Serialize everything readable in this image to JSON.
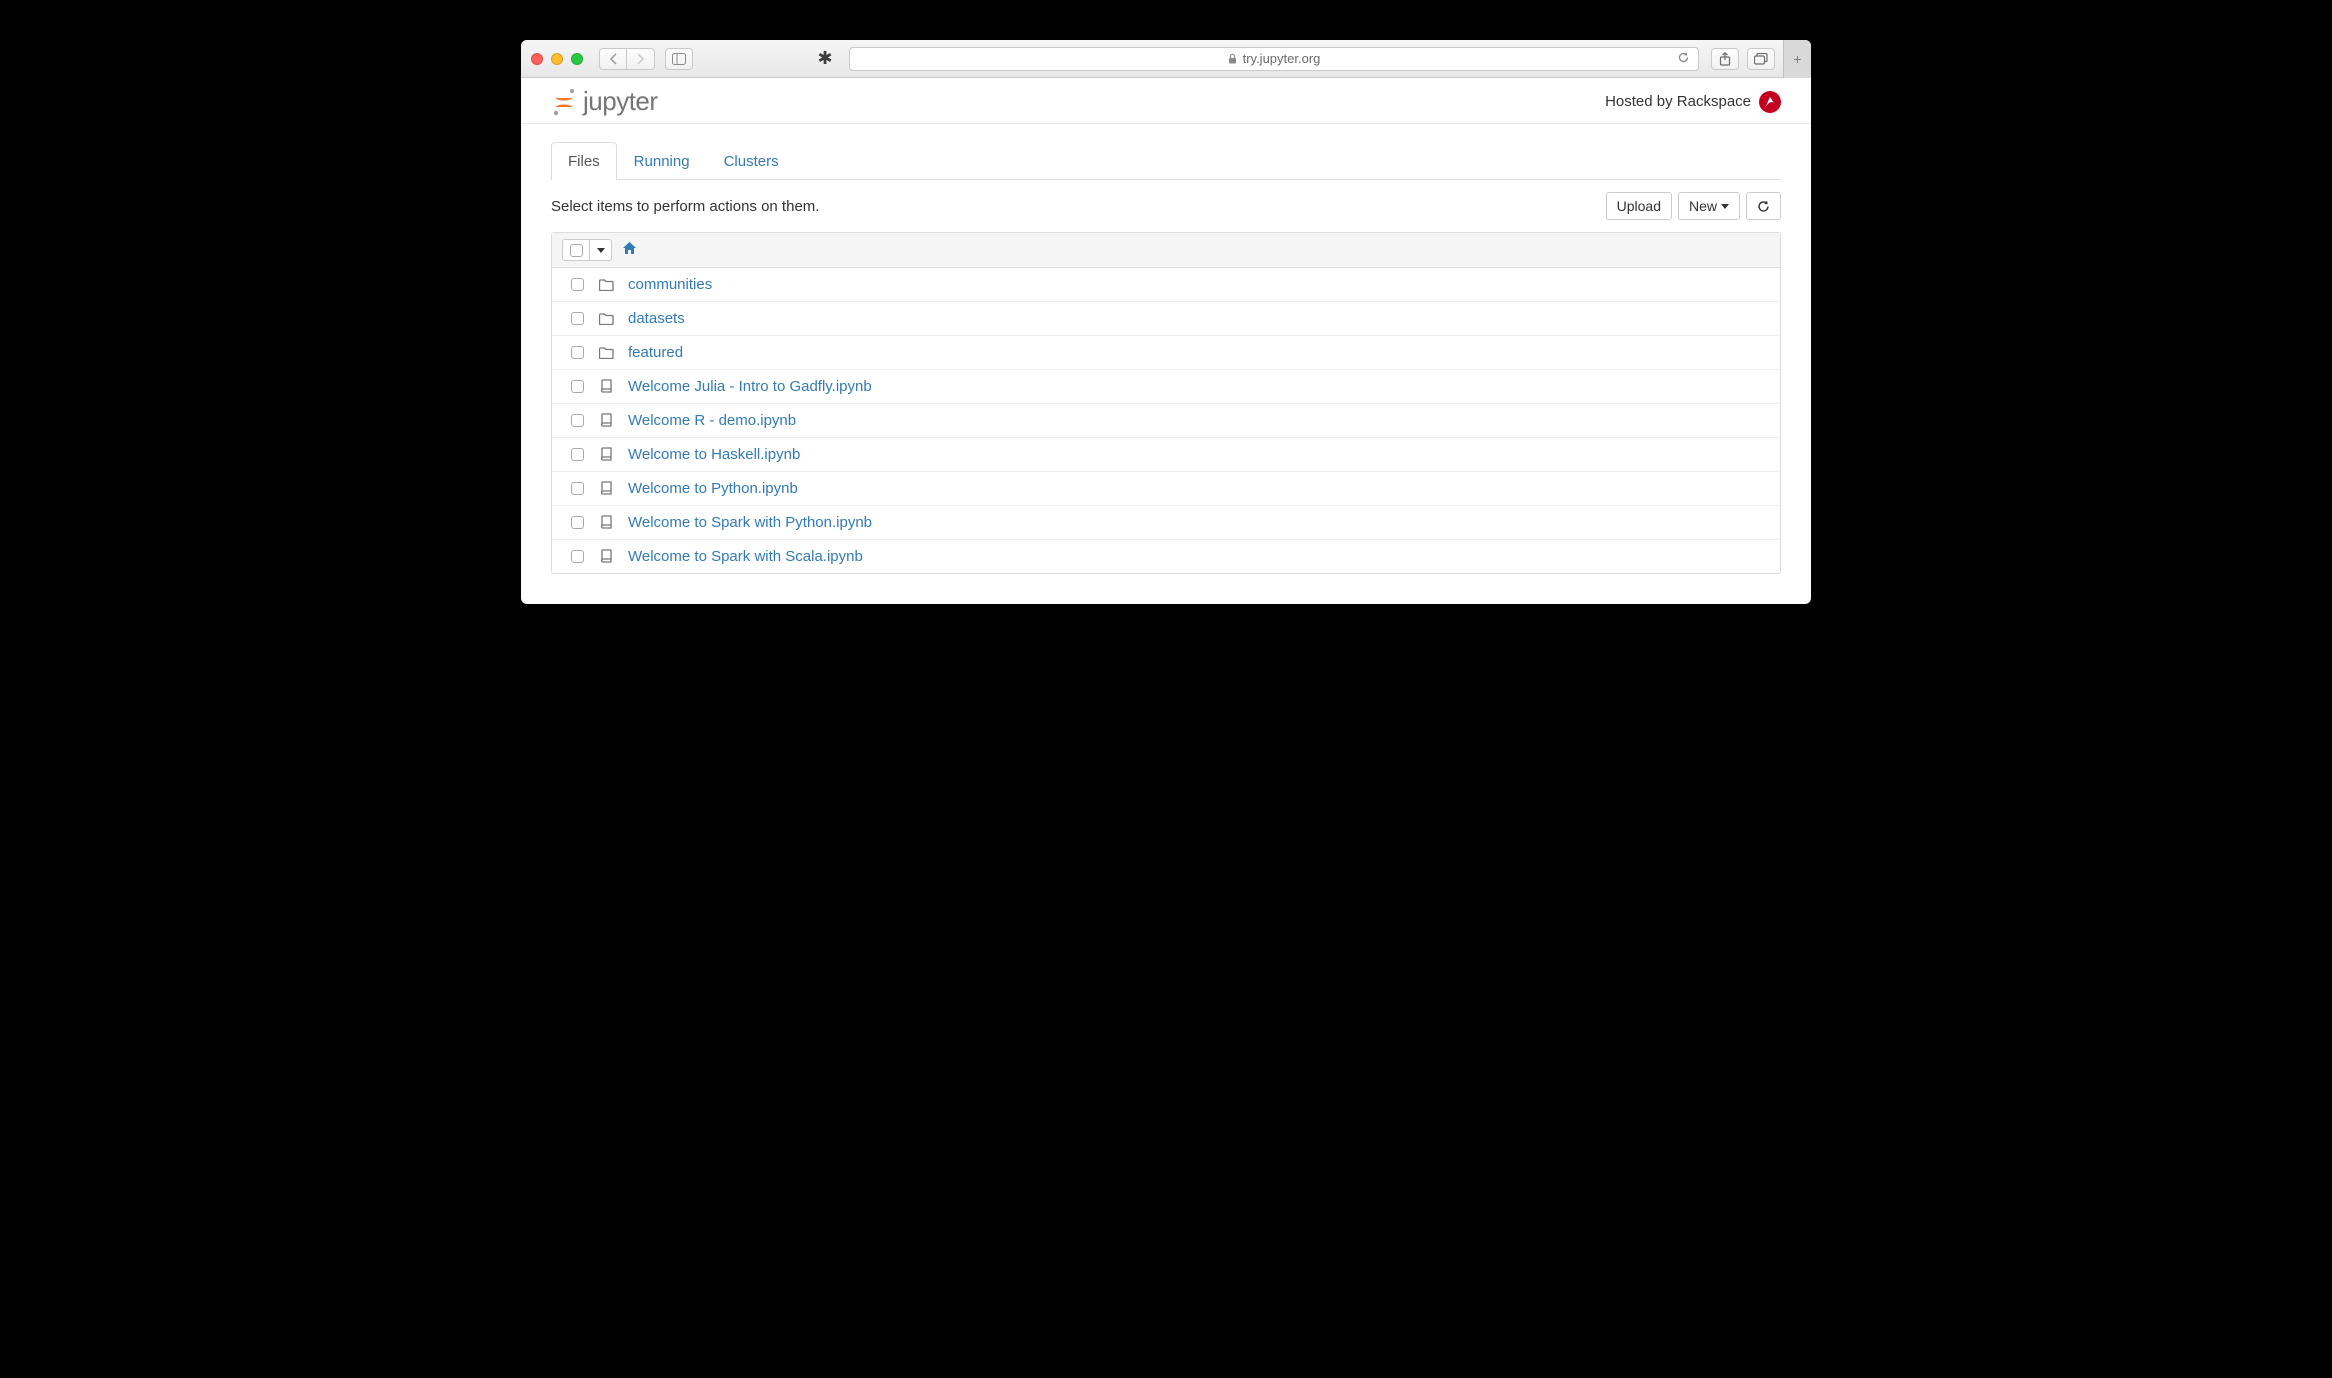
{
  "browser": {
    "url": "try.jupyter.org"
  },
  "header": {
    "logo_text": "jupyter",
    "hosted_by": "Hosted by Rackspace"
  },
  "tabs": {
    "files": "Files",
    "running": "Running",
    "clusters": "Clusters"
  },
  "toolbar": {
    "hint": "Select items to perform actions on them.",
    "upload": "Upload",
    "new": "New"
  },
  "files": [
    {
      "type": "folder",
      "name": "communities"
    },
    {
      "type": "folder",
      "name": "datasets"
    },
    {
      "type": "folder",
      "name": "featured"
    },
    {
      "type": "notebook",
      "name": "Welcome Julia - Intro to Gadfly.ipynb"
    },
    {
      "type": "notebook",
      "name": "Welcome R - demo.ipynb"
    },
    {
      "type": "notebook",
      "name": "Welcome to Haskell.ipynb"
    },
    {
      "type": "notebook",
      "name": "Welcome to Python.ipynb"
    },
    {
      "type": "notebook",
      "name": "Welcome to Spark with Python.ipynb"
    },
    {
      "type": "notebook",
      "name": "Welcome to Spark with Scala.ipynb"
    }
  ]
}
